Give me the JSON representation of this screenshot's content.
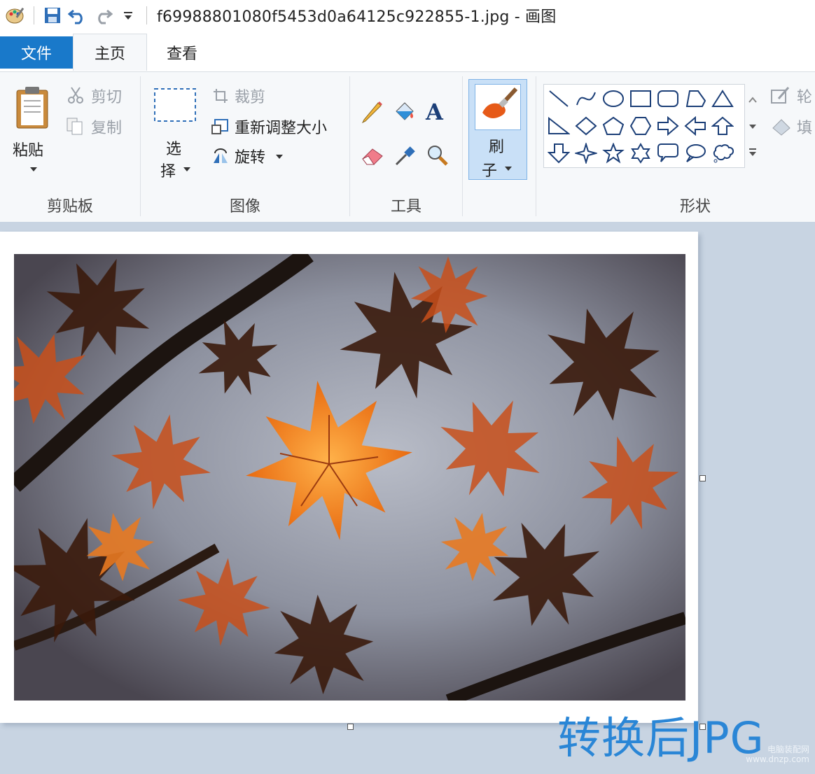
{
  "window": {
    "title": "f69988801080f5453d0a64125c922855-1.jpg - 画图"
  },
  "tabs": {
    "file": "文件",
    "home": "主页",
    "view": "查看"
  },
  "clipboard": {
    "paste": "粘贴",
    "cut": "剪切",
    "copy": "复制",
    "group_label": "剪贴板"
  },
  "image": {
    "select_top": "选",
    "select_bottom": "择",
    "crop": "裁剪",
    "resize": "重新调整大小",
    "rotate": "旋转",
    "group_label": "图像"
  },
  "tools": {
    "group_label": "工具",
    "text_glyph": "A"
  },
  "brush": {
    "label_top": "刷",
    "label_bottom": "子"
  },
  "shapes": {
    "group_label": "形状",
    "outline": "轮",
    "fill": "填",
    "items": [
      "line",
      "curve",
      "oval",
      "rectangle",
      "rounded-rectangle",
      "polygon",
      "triangle",
      "right-triangle",
      "diamond",
      "pentagon",
      "hexagon",
      "right-arrow",
      "left-arrow",
      "up-arrow",
      "down-arrow",
      "four-point-star",
      "five-point-star",
      "six-point-star",
      "rounded-callout",
      "oval-callout",
      "cloud-callout"
    ]
  },
  "overlay": {
    "text": "转换后JPG"
  },
  "watermark": {
    "line1": "电脑装配网",
    "line2": "www.dnzp.com"
  },
  "colors": {
    "accent": "#1979ca",
    "ribbon_bg": "#f6f8fa",
    "workspace_bg": "#c8d4e2",
    "overlay_text": "#2a86d6"
  }
}
